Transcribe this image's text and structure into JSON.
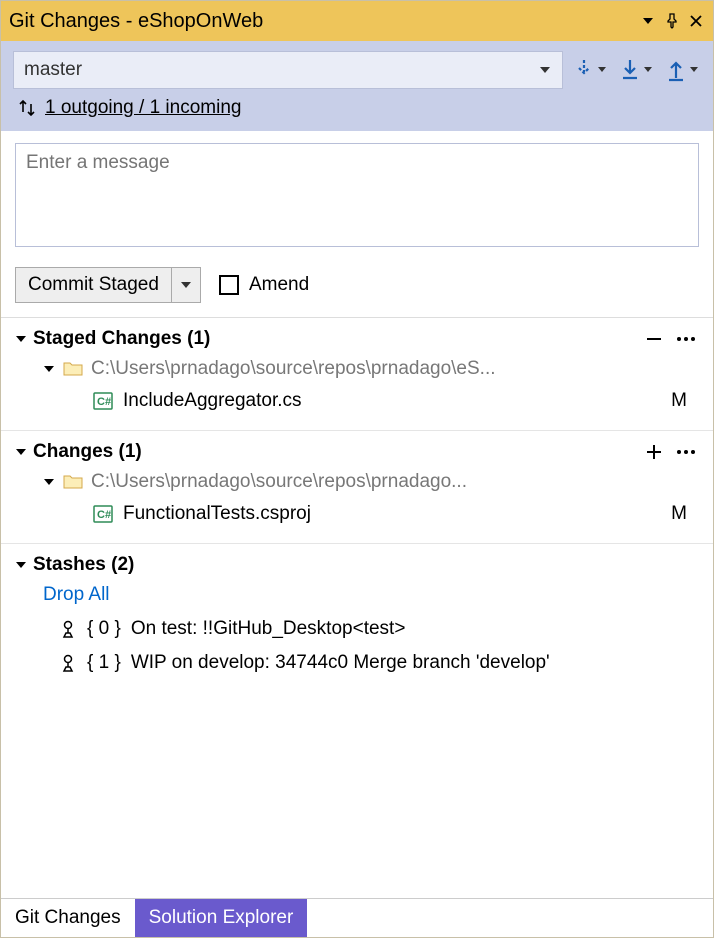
{
  "titlebar": {
    "title": "Git Changes - eShopOnWeb"
  },
  "branch": {
    "current": "master"
  },
  "sync": {
    "text": "1 outgoing / 1 incoming"
  },
  "message": {
    "placeholder": "Enter a message"
  },
  "commit": {
    "button": "Commit Staged",
    "amend": "Amend"
  },
  "staged": {
    "title": "Staged Changes (1)",
    "folder": "C:\\Users\\prnadago\\source\\repos\\prnadago\\eS...",
    "file": "IncludeAggregator.cs",
    "status": "M"
  },
  "changes": {
    "title": "Changes (1)",
    "folder": "C:\\Users\\prnadago\\source\\repos\\prnadago...",
    "file": "FunctionalTests.csproj",
    "status": "M"
  },
  "stashes": {
    "title": "Stashes (2)",
    "dropall": "Drop All",
    "items": [
      {
        "idx": "{ 0 }",
        "text": "On test: !!GitHub_Desktop<test>"
      },
      {
        "idx": "{ 1 }",
        "text": "WIP on develop: 34744c0 Merge branch 'develop'"
      }
    ]
  },
  "tabs": {
    "git": "Git Changes",
    "solution": "Solution Explorer"
  }
}
